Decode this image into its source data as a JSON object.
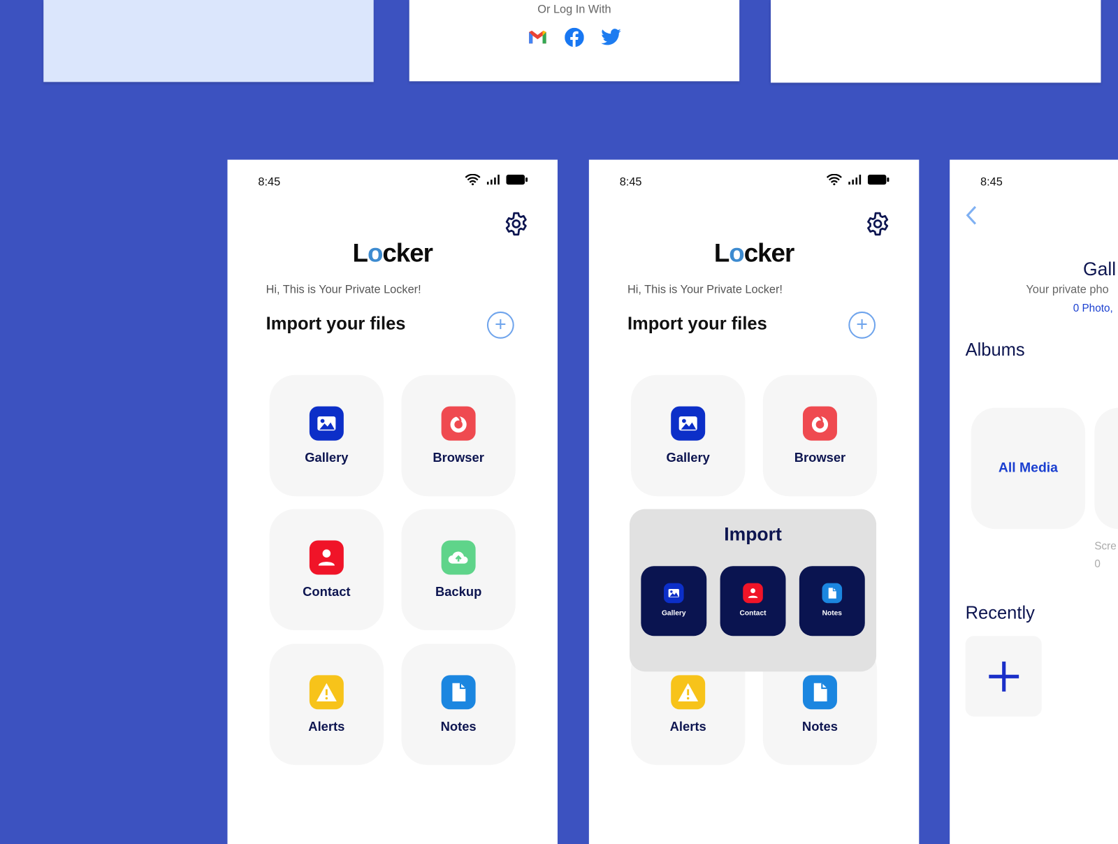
{
  "colors": {
    "background": "#3c52c0",
    "navy": "#0d1550",
    "accent": "#6fa4ec",
    "link": "#1a3fd0"
  },
  "login_card": {
    "text": "Or Log In With",
    "icons": [
      "gmail-icon",
      "facebook-icon",
      "twitter-icon"
    ]
  },
  "home": {
    "time": "8:45",
    "logo": {
      "pre": "L",
      "o": "o",
      "post": "cker"
    },
    "greeting": "Hi, This is Your Private Locker!",
    "import_title": "Import your files",
    "tiles": [
      {
        "label": "Gallery",
        "icon": "gallery-icon",
        "color": "#0c2fc8"
      },
      {
        "label": "Browser",
        "icon": "browser-icon",
        "color": "#ef4a50"
      },
      {
        "label": "Contact",
        "icon": "contact-icon",
        "color": "#f01428"
      },
      {
        "label": "Backup",
        "icon": "cloud-upload-icon",
        "color": "#5fd48a"
      },
      {
        "label": "Alerts",
        "icon": "warning-icon",
        "color": "#f7c31a"
      },
      {
        "label": "Notes",
        "icon": "notes-icon",
        "color": "#1b86e0"
      }
    ]
  },
  "import_popup": {
    "title": "Import",
    "items": [
      {
        "label": "Gallery",
        "icon": "gallery-icon"
      },
      {
        "label": "Contact",
        "icon": "contact-icon"
      },
      {
        "label": "Notes",
        "icon": "notes-icon"
      }
    ]
  },
  "gallery": {
    "time": "8:45",
    "title": "Gall",
    "subtitle": "Your private pho",
    "count": "0 Photo,",
    "albums_title": "Albums",
    "albums": [
      {
        "label": "All Media"
      },
      {
        "label": "Scre",
        "count": "0"
      }
    ],
    "recently_title": "Recently"
  }
}
